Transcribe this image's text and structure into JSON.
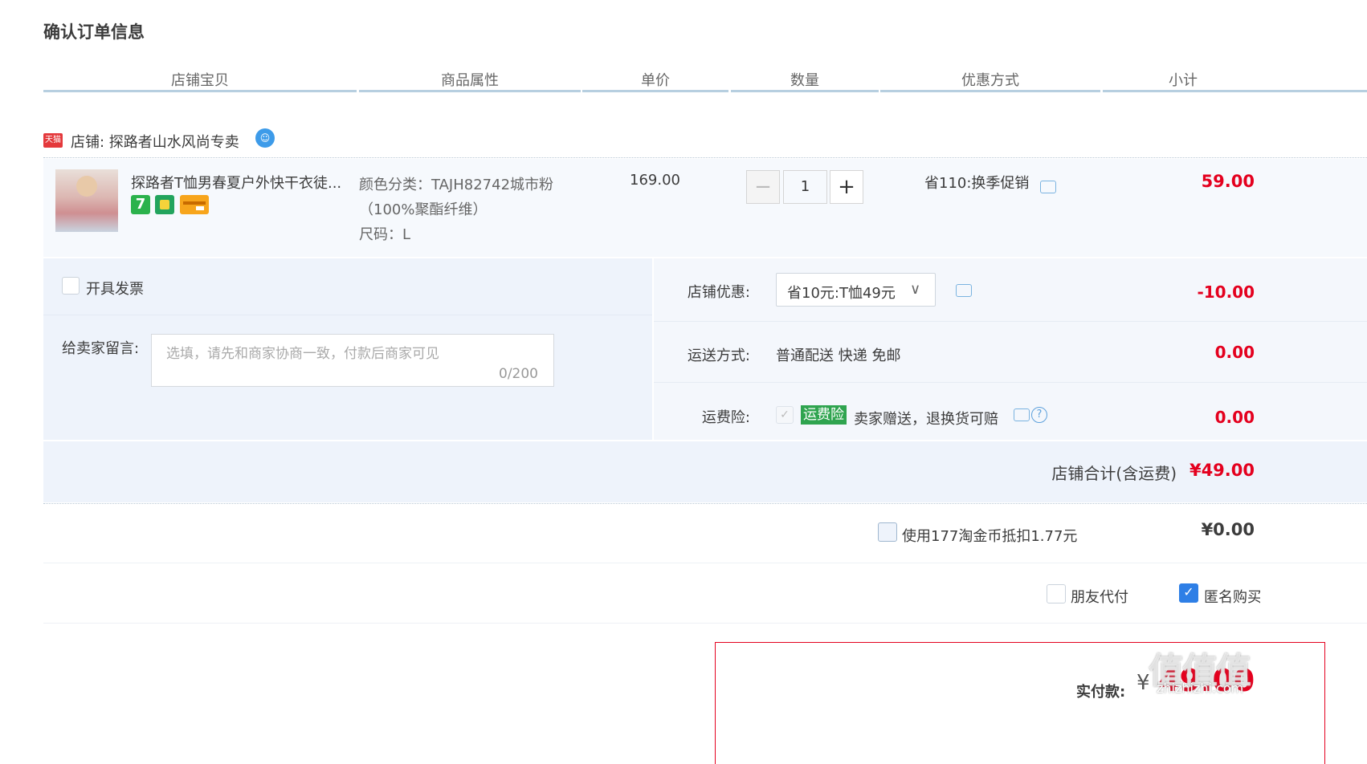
{
  "page_title": "确认订单信息",
  "columns": [
    "店铺宝贝",
    "商品属性",
    "单价",
    "数量",
    "优惠方式",
    "小计"
  ],
  "shop": {
    "logo_text": "天猫",
    "name": "店铺: 探路者山水风尚专卖"
  },
  "item": {
    "title": "探路者T恤男春夏户外快干衣徒...",
    "attr_color": "颜色分类：TAJH82742城市粉",
    "attr_material": "（100%聚酯纤维）",
    "attr_size": "尺码：L",
    "price": "169.00",
    "quantity": "1",
    "promo": "省110:换季促销",
    "subtotal": "59.00",
    "badges": [
      {
        "icon": "seven-day-return-icon",
        "text": "7",
        "color": "#2bb24c"
      },
      {
        "icon": "bag-icon",
        "text": "",
        "color": "#22a45d"
      },
      {
        "icon": "card-icon",
        "text": "",
        "color": "#f7a51c"
      }
    ]
  },
  "invoice": {
    "label": "开具发票"
  },
  "message": {
    "label": "给卖家留言:",
    "placeholder": "选填，请先和商家协商一致，付款后商家可见",
    "count": "0/200"
  },
  "shop_discount": {
    "label": "店铺优惠:",
    "selected": "省10元:T恤49元",
    "value": "-10.00"
  },
  "shipping": {
    "label": "运送方式:",
    "method": "普通配送 快递 免邮",
    "value": "0.00"
  },
  "insurance": {
    "label": "运费险:",
    "tag": "运费险",
    "desc": "卖家赠送，退换货可赔",
    "value": "0.00"
  },
  "shop_total": {
    "label": "店铺合计(含运费)",
    "value": "¥49.00"
  },
  "coins": {
    "label": "使用177淘金币抵扣1.77元",
    "value": "¥0.00"
  },
  "options": {
    "friend_pay": "朋友代付",
    "anonymous": "匿名购买"
  },
  "payment": {
    "label": "实付款:",
    "currency": "¥",
    "amount": "49.00"
  },
  "watermark": {
    "main": "值值值",
    "sub": "zhizhizhi.com"
  },
  "colors": {
    "accent_red": "#e4001e",
    "header_line": "#b7cfe0",
    "panel_bg": "#eef3fb",
    "insurance_green": "#2fa44f",
    "check_blue": "#2e7fe6"
  }
}
